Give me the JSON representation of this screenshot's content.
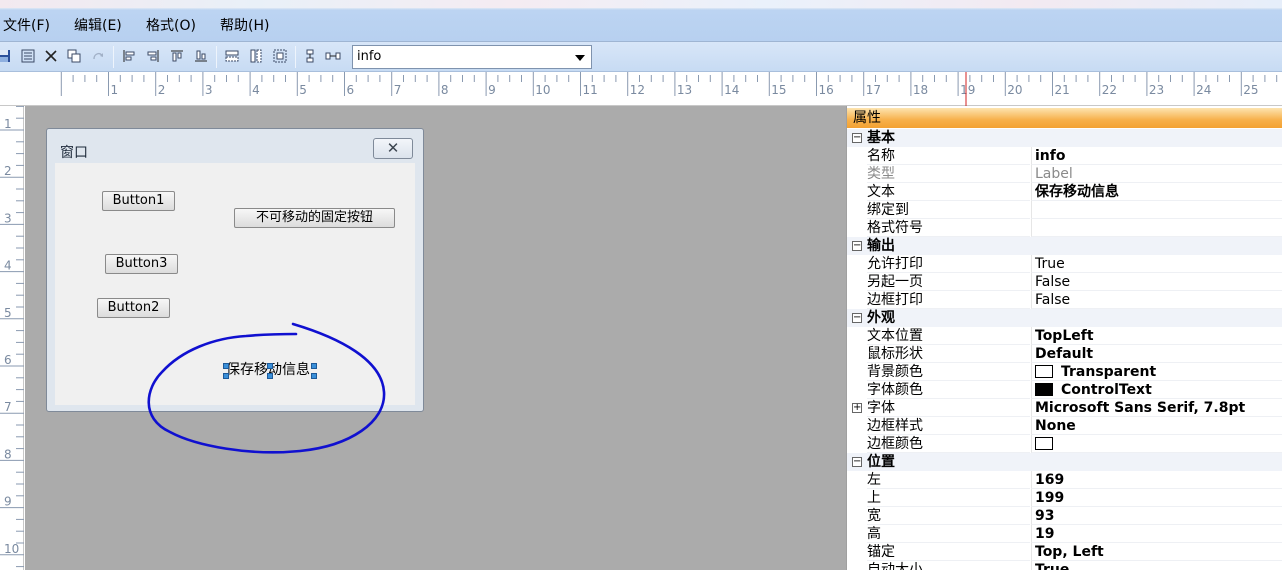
{
  "menu": [
    {
      "label": "文件(F)"
    },
    {
      "label": "编辑(E)"
    },
    {
      "label": "格式(O)"
    },
    {
      "label": "帮助(H)"
    }
  ],
  "toolbar": {
    "combo_value": "info",
    "icons": [
      "save-icon",
      "list-icon",
      "delete-icon",
      "copy-icon",
      "redo-icon",
      "align-left-icon",
      "align-right-icon",
      "align-top-icon",
      "align-bottom-icon",
      "same-width-icon",
      "same-height-icon",
      "same-size-icon",
      "vertical-spacing-icon",
      "horizontal-spacing-icon"
    ]
  },
  "ruler": {
    "h_numbers": [
      "1",
      "2",
      "3",
      "4",
      "5",
      "6",
      "7",
      "8",
      "9",
      "10",
      "11",
      "12",
      "13",
      "14",
      "15",
      "16",
      "17",
      "18",
      "19",
      "20",
      "21",
      "22",
      "23",
      "24",
      "25"
    ],
    "v_numbers": [
      "1",
      "2",
      "3",
      "4",
      "5",
      "6",
      "7",
      "8",
      "9",
      "10"
    ]
  },
  "form": {
    "title": "窗口",
    "close_glyph": "✕",
    "buttons": [
      {
        "label": "Button1"
      },
      {
        "label": "不可移动的固定按钮"
      },
      {
        "label": "Button3"
      },
      {
        "label": "Button2"
      }
    ],
    "selected_label": "保存移动信息"
  },
  "properties": {
    "header": "属性",
    "sections": {
      "basic": {
        "title": "基本",
        "rows": [
          {
            "name": "名称",
            "value": "info"
          },
          {
            "name": "类型",
            "value": "Label"
          },
          {
            "name": "文本",
            "value": "保存移动信息"
          },
          {
            "name": "绑定到",
            "value": ""
          },
          {
            "name": "格式符号",
            "value": ""
          }
        ]
      },
      "output": {
        "title": "输出",
        "rows": [
          {
            "name": "允许打印",
            "value": "True"
          },
          {
            "name": "另起一页",
            "value": "False"
          },
          {
            "name": "边框打印",
            "value": "False"
          }
        ]
      },
      "appearance": {
        "title": "外观",
        "rows": [
          {
            "name": "文本位置",
            "value": "TopLeft"
          },
          {
            "name": "鼠标形状",
            "value": "Default"
          },
          {
            "name": "背景颜色",
            "value": "Transparent",
            "color": "#ffffff"
          },
          {
            "name": "字体颜色",
            "value": "ControlText",
            "color": "#000000"
          },
          {
            "name": "字体",
            "value": "Microsoft Sans Serif, 7.8pt"
          },
          {
            "name": "边框样式",
            "value": "None"
          },
          {
            "name": "边框颜色",
            "value": "",
            "color": "#ffffff"
          }
        ]
      },
      "position": {
        "title": "位置",
        "rows": [
          {
            "name": "左",
            "value": "169"
          },
          {
            "name": "上",
            "value": "199"
          },
          {
            "name": "宽",
            "value": "93"
          },
          {
            "name": "高",
            "value": "19"
          },
          {
            "name": "锚定",
            "value": "Top, Left"
          },
          {
            "name": "自动大小",
            "value": "True"
          }
        ]
      }
    }
  },
  "colors": {
    "annotation_stroke": "#1010d0",
    "header_orange": "#f7b04a",
    "canvas_grey": "#ababab"
  }
}
